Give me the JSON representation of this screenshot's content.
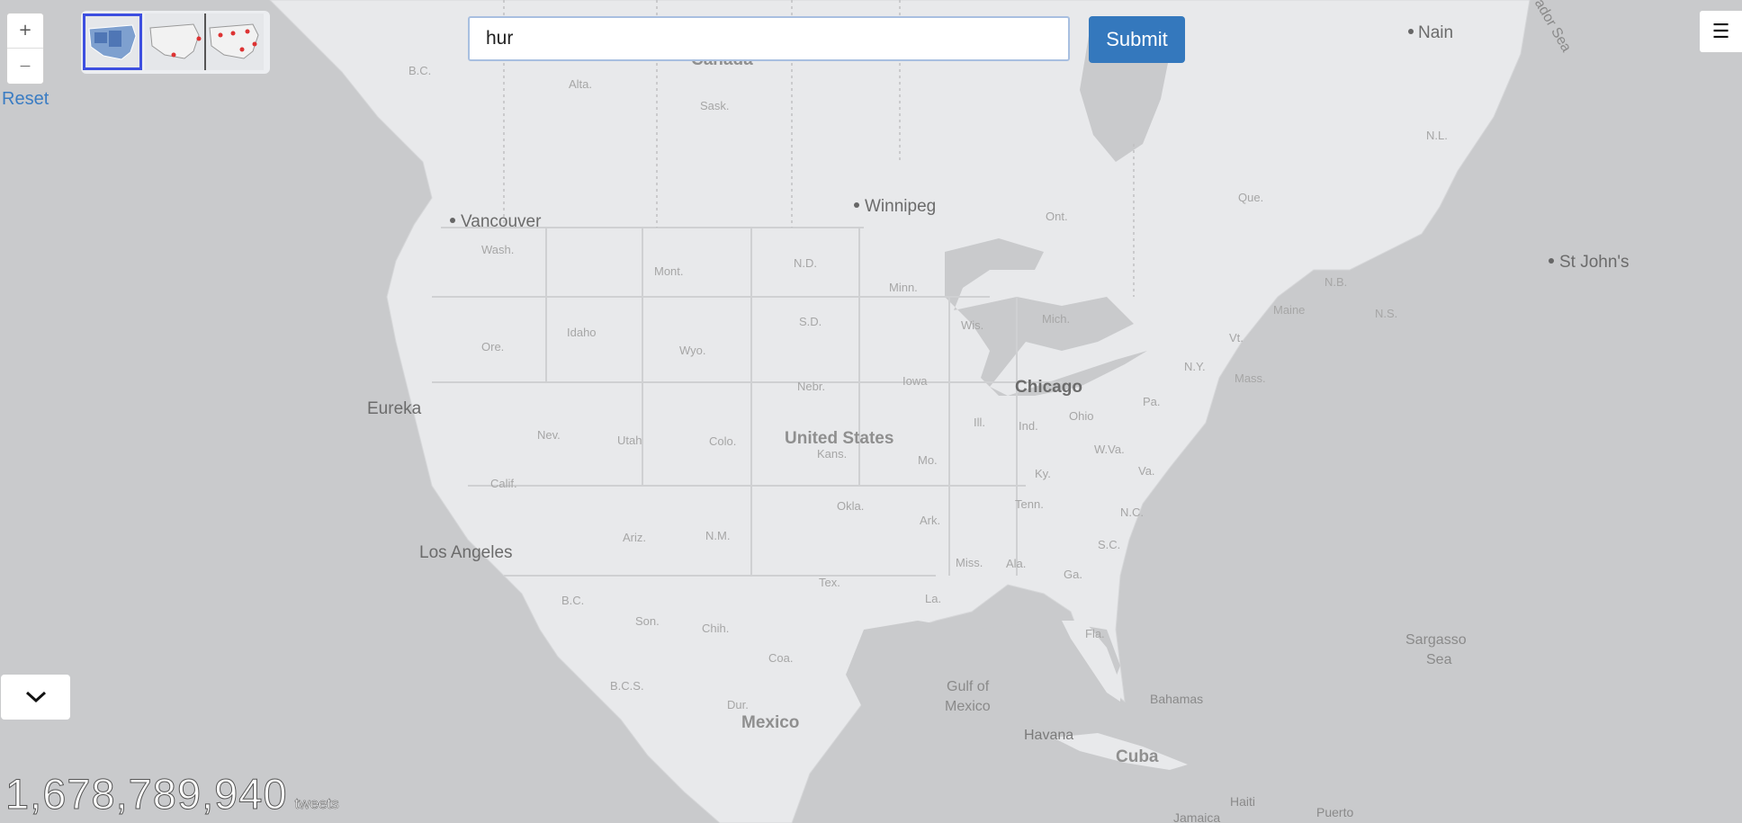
{
  "zoom": {
    "in_label": "+",
    "out_label": "—"
  },
  "reset_label": "Reset",
  "search": {
    "value": "hur"
  },
  "submit_label": "Submit",
  "menu_icon": "hamburger-icon",
  "layers": [
    {
      "name": "choropleth-map-thumbnail",
      "active": true
    },
    {
      "name": "points-map-thumbnail",
      "active": false
    },
    {
      "name": "grid-points-map-thumbnail",
      "active": false
    }
  ],
  "counter": {
    "value": "1,678,789,940",
    "unit": "tweets"
  },
  "map": {
    "cities": {
      "nain": "Nain",
      "vancouver": "Vancouver",
      "winnipeg": "Winnipeg",
      "st_johns": "St John's",
      "eureka": "Eureka",
      "los_angeles": "Los Angeles",
      "chicago": "Chicago",
      "havana": "Havana"
    },
    "countries": {
      "canada": "Canada",
      "us": "United States",
      "mexico": "Mexico",
      "cuba": "Cuba"
    },
    "water": {
      "labrador": "rador Sea",
      "gulf_1": "Gulf of",
      "gulf_2": "Mexico",
      "sargasso_1": "Sargasso",
      "sargasso_2": "Sea"
    },
    "regions": {
      "bahamas": "Bahamas",
      "haiti": "Haiti",
      "puerto": "Puerto",
      "jamaica": "Jamaica",
      "bc": "B.C.",
      "alta": "Alta.",
      "sask": "Sask.",
      "ont": "Ont.",
      "que": "Que.",
      "nl": "N.L.",
      "nb": "N.B.",
      "ns": "N.S.",
      "son": "Son.",
      "chih": "Chih.",
      "coa": "Coa.",
      "dur": "Dur.",
      "bcs": "B.C.S.",
      "bc_mx": "B.C."
    },
    "states": {
      "wash": "Wash.",
      "ore": "Ore.",
      "calif": "Calif.",
      "idaho": "Idaho",
      "nev": "Nev.",
      "mont": "Mont.",
      "wyo": "Wyo.",
      "utah": "Utah",
      "ariz": "Ariz.",
      "colo": "Colo.",
      "nm": "N.M.",
      "nd": "N.D.",
      "sd": "S.D.",
      "nebr": "Nebr.",
      "kans": "Kans.",
      "okla": "Okla.",
      "tex": "Tex.",
      "minn": "Minn.",
      "iowa": "Iowa",
      "mo": "Mo.",
      "ark": "Ark.",
      "la": "La.",
      "wis": "Wis.",
      "ill": "Ill.",
      "mich": "Mich.",
      "ind": "Ind.",
      "ohio": "Ohio",
      "ky": "Ky.",
      "tenn": "Tenn.",
      "miss": "Miss.",
      "ala": "Ala.",
      "ga": "Ga.",
      "fla": "Fla.",
      "sc": "S.C.",
      "nc": "N.C.",
      "va": "Va.",
      "wva": "W.Va.",
      "pa": "Pa.",
      "ny": "N.Y.",
      "vt": "Vt.",
      "maine": "Maine",
      "mass": "Mass."
    }
  }
}
